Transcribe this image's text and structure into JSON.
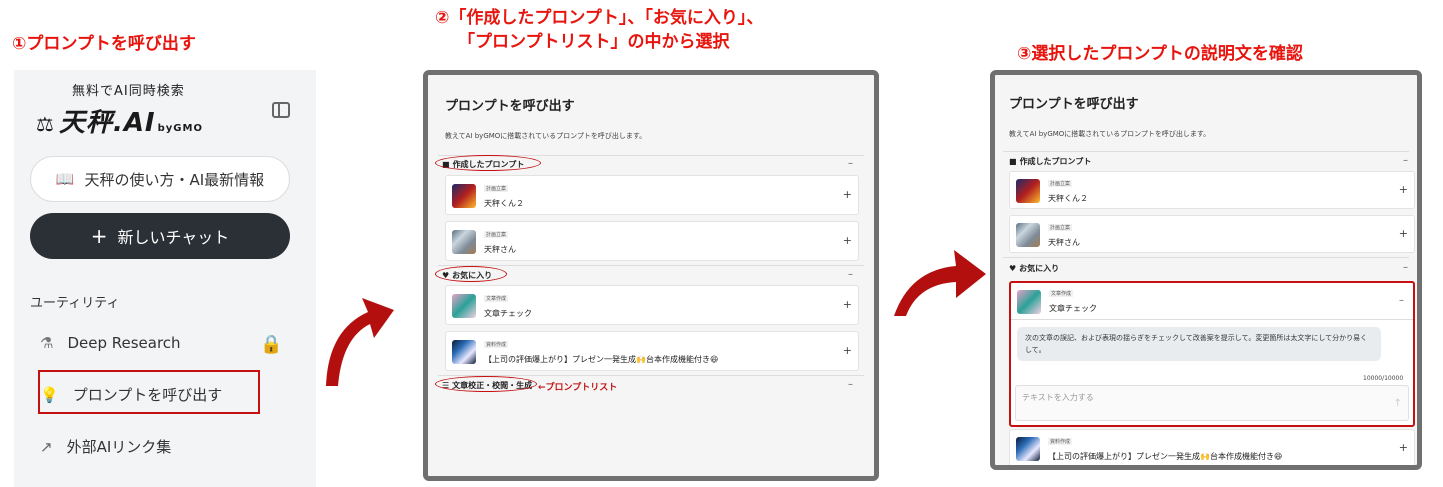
{
  "steps": {
    "step1": "①プロンプトを呼び出す",
    "step2_line1": "②「作成したプロンプト」、「お気に入り」、",
    "step2_line2": "「プロンプトリスト」の中から選択",
    "step3": "③選択したプロンプトの説明文を確認"
  },
  "sidebar": {
    "brand_tagline": "無料でAI同時検索",
    "brand_name": "天秤.AI",
    "brand_suffix": "byGMO",
    "guide_label": "天秤の使い方・AI最新情報",
    "new_chat_label": "新しいチャット",
    "section_label": "ユーティリティ",
    "items": [
      {
        "label": "Deep Research",
        "icon": "flask-icon"
      },
      {
        "label": "プロンプトを呼び出す",
        "icon": "bulb-icon"
      },
      {
        "label": "外部AIリンク集",
        "icon": "external-link-icon"
      }
    ]
  },
  "dialog": {
    "title": "プロンプトを呼び出す",
    "description": "教えてAI byGMOに搭載されているプロンプトを呼び出します。",
    "group_created": "作成したプロンプト",
    "group_favorites": "お気に入り",
    "group_list": "文章校正・校閲・生成",
    "prompts": [
      {
        "category": "計画立案",
        "name": "天秤くん２"
      },
      {
        "category": "計画立案",
        "name": "天秤さん"
      },
      {
        "category": "文章作成",
        "name": "文章チェック"
      },
      {
        "category": "資料作成",
        "name": "【上司の評価爆上がり】プレゼン一発生成🙌台本作成機能付き😆"
      }
    ],
    "prompt_list_annotation": "プロンプトリスト",
    "expanded_description": "次の文章の誤記、および表現の揺らぎをチェックして改善案を提示して。変更箇所は太文字にして分かり易くして。",
    "counter": "10000/10000",
    "input_placeholder": "テキストを入力する"
  },
  "colors": {
    "annotation_red": "#e8150e",
    "dark_button": "#2b2f36",
    "lock_blue": "#1e5fd6"
  }
}
